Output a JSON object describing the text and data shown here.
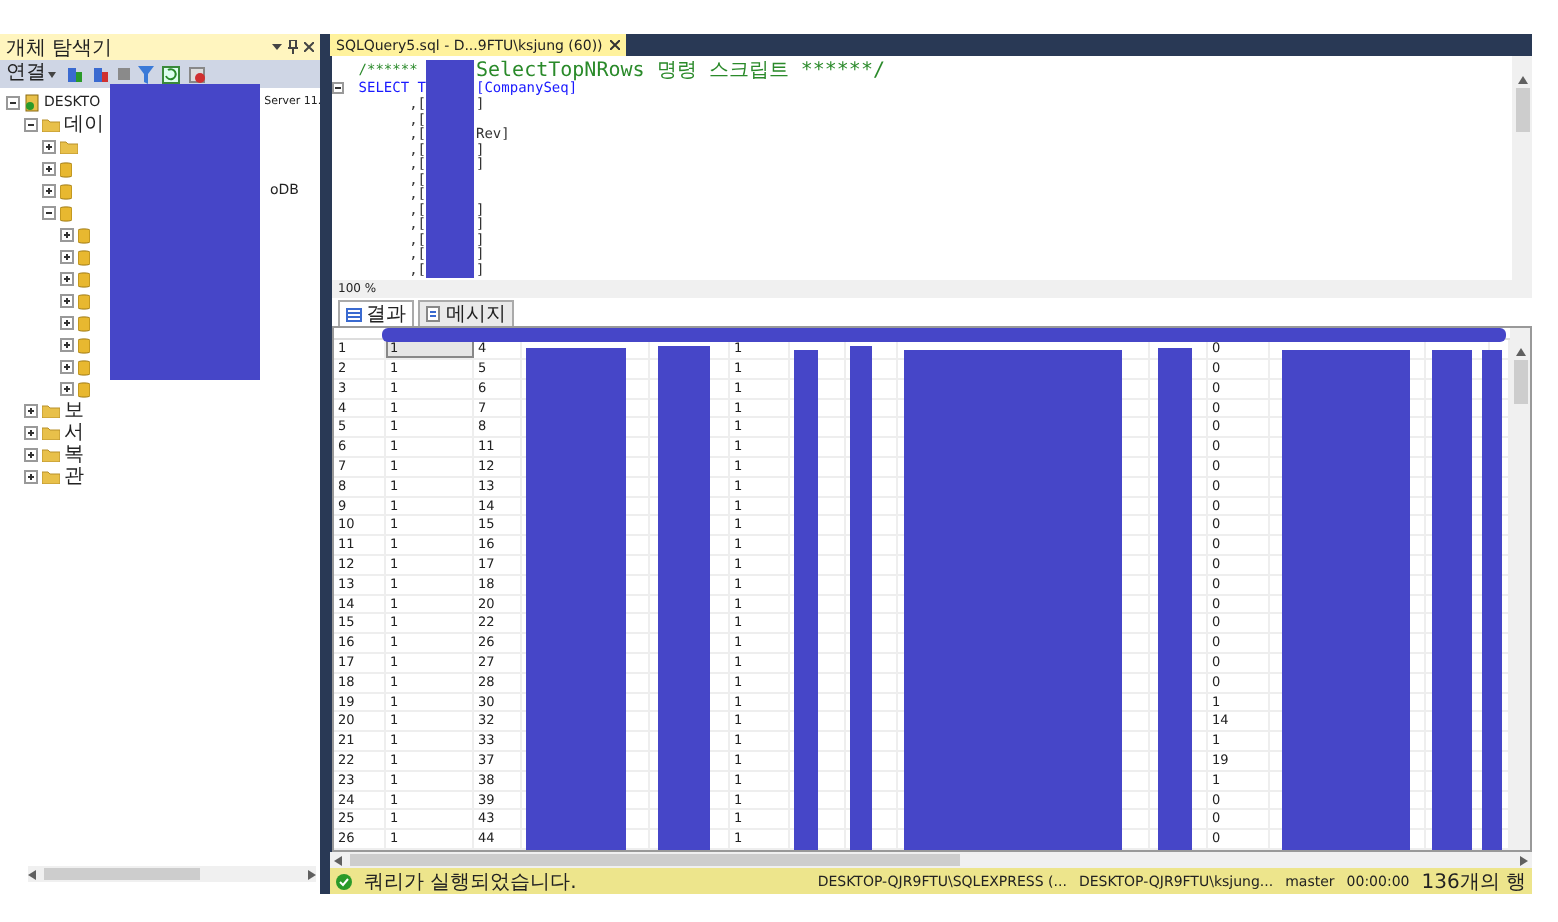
{
  "object_explorer": {
    "title": "개체 탐색기",
    "connect": "연결",
    "tree": [
      {
        "kind": "server",
        "label": "DESKTO",
        "label_after": "Server 11.",
        "expanded": true,
        "children": [
          {
            "kind": "folder",
            "label": "데이",
            "expanded": true,
            "children": [
              {
                "kind": "folder",
                "expanded": false
              },
              {
                "kind": "database",
                "expanded": false
              },
              {
                "kind": "database",
                "label_after": "oDB",
                "expanded": false
              },
              {
                "kind": "database",
                "expanded": true,
                "children": [
                  {
                    "kind": "database",
                    "expanded": false
                  },
                  {
                    "kind": "database",
                    "expanded": false
                  },
                  {
                    "kind": "database",
                    "expanded": false
                  },
                  {
                    "kind": "database",
                    "expanded": false
                  },
                  {
                    "kind": "database",
                    "expanded": false
                  },
                  {
                    "kind": "database",
                    "expanded": false
                  },
                  {
                    "kind": "database",
                    "expanded": false
                  },
                  {
                    "kind": "database",
                    "expanded": false
                  }
                ]
              }
            ]
          },
          {
            "kind": "folder",
            "label": "보",
            "expanded": false
          },
          {
            "kind": "folder",
            "label": "서",
            "expanded": false
          },
          {
            "kind": "folder",
            "label": "복",
            "expanded": false
          },
          {
            "kind": "folder",
            "label": "관",
            "expanded": false
          }
        ]
      }
    ]
  },
  "editor": {
    "tab": "SQLQuery5.sql - D...9FTU\\ksjung (60))",
    "zoom": "100 %",
    "lines": [
      {
        "kind": "comment",
        "before": "/****** ",
        "after": "SelectTopNRows 명령 스크립트 ******/"
      },
      {
        "kind": "keyword",
        "before": "SELECT T",
        "after": "[CompanySeq]"
      },
      {
        "kind": "plain",
        "before": ",[",
        "after": "]"
      },
      {
        "kind": "plain",
        "before": ",["
      },
      {
        "kind": "plain",
        "before": ",[",
        "after": "Rev]"
      },
      {
        "kind": "plain",
        "before": ",[",
        "after": "]"
      },
      {
        "kind": "plain",
        "before": ",[",
        "after": "]"
      },
      {
        "kind": "plain",
        "before": ",["
      },
      {
        "kind": "plain",
        "before": ",["
      },
      {
        "kind": "plain",
        "before": ",[",
        "after": "]"
      },
      {
        "kind": "plain",
        "before": ",[",
        "after": "]"
      },
      {
        "kind": "plain",
        "before": ",[",
        "after": "]"
      },
      {
        "kind": "plain",
        "before": ",[",
        "after": "]"
      },
      {
        "kind": "plain",
        "before": ",[",
        "after": "]"
      }
    ]
  },
  "results": {
    "tabs": [
      {
        "label": "결과",
        "kind": "grid",
        "selected": true
      },
      {
        "label": "메시지",
        "kind": "messages",
        "selected": false
      }
    ],
    "rows": [
      {
        "number": "1",
        "column_1": "1",
        "column_2": "4",
        "column_5": "1",
        "column_10": "0",
        "selected": true
      },
      {
        "number": "2",
        "column_1": "1",
        "column_2": "5",
        "column_5": "1",
        "column_10": "0",
        "selected": false
      },
      {
        "number": "3",
        "column_1": "1",
        "column_2": "6",
        "column_5": "1",
        "column_10": "0",
        "selected": false
      },
      {
        "number": "4",
        "column_1": "1",
        "column_2": "7",
        "column_5": "1",
        "column_10": "0",
        "selected": false
      },
      {
        "number": "5",
        "column_1": "1",
        "column_2": "8",
        "column_5": "1",
        "column_10": "0",
        "selected": false
      },
      {
        "number": "6",
        "column_1": "1",
        "column_2": "11",
        "column_5": "1",
        "column_10": "0",
        "selected": false
      },
      {
        "number": "7",
        "column_1": "1",
        "column_2": "12",
        "column_5": "1",
        "column_10": "0",
        "selected": false
      },
      {
        "number": "8",
        "column_1": "1",
        "column_2": "13",
        "column_5": "1",
        "column_10": "0",
        "selected": false
      },
      {
        "number": "9",
        "column_1": "1",
        "column_2": "14",
        "column_5": "1",
        "column_10": "0",
        "selected": false
      },
      {
        "number": "10",
        "column_1": "1",
        "column_2": "15",
        "column_5": "1",
        "column_10": "0",
        "selected": false
      },
      {
        "number": "11",
        "column_1": "1",
        "column_2": "16",
        "column_5": "1",
        "column_10": "0",
        "selected": false
      },
      {
        "number": "12",
        "column_1": "1",
        "column_2": "17",
        "column_5": "1",
        "column_10": "0",
        "selected": false
      },
      {
        "number": "13",
        "column_1": "1",
        "column_2": "18",
        "column_5": "1",
        "column_10": "0",
        "selected": false
      },
      {
        "number": "14",
        "column_1": "1",
        "column_2": "20",
        "column_5": "1",
        "column_10": "0",
        "selected": false
      },
      {
        "number": "15",
        "column_1": "1",
        "column_2": "22",
        "column_5": "1",
        "column_10": "0",
        "selected": false
      },
      {
        "number": "16",
        "column_1": "1",
        "column_2": "26",
        "column_5": "1",
        "column_10": "0",
        "selected": false
      },
      {
        "number": "17",
        "column_1": "1",
        "column_2": "27",
        "column_5": "1",
        "column_10": "0",
        "selected": false
      },
      {
        "number": "18",
        "column_1": "1",
        "column_2": "28",
        "column_5": "1",
        "column_10": "0",
        "selected": false
      },
      {
        "number": "19",
        "column_1": "1",
        "column_2": "30",
        "column_5": "1",
        "column_10": "1",
        "selected": false
      },
      {
        "number": "20",
        "column_1": "1",
        "column_2": "32",
        "column_5": "1",
        "column_10": "14",
        "selected": false
      },
      {
        "number": "21",
        "column_1": "1",
        "column_2": "33",
        "column_5": "1",
        "column_10": "1",
        "selected": false
      },
      {
        "number": "22",
        "column_1": "1",
        "column_2": "37",
        "column_5": "1",
        "column_10": "19",
        "selected": false
      },
      {
        "number": "23",
        "column_1": "1",
        "column_2": "38",
        "column_5": "1",
        "column_10": "1",
        "selected": false
      },
      {
        "number": "24",
        "column_1": "1",
        "column_2": "39",
        "column_5": "1",
        "column_10": "0",
        "selected": false
      },
      {
        "number": "25",
        "column_1": "1",
        "column_2": "43",
        "column_5": "1",
        "column_10": "0",
        "selected": false
      },
      {
        "number": "26",
        "column_1": "1",
        "column_2": "44",
        "column_5": "1",
        "column_10": "0",
        "selected": false
      }
    ]
  },
  "status_bar": {
    "message": "쿼리가 실행되었습니다.",
    "server": "DESKTOP-QJR9FTU\\SQLEXPRESS (...",
    "user": "DESKTOP-QJR9FTU\\ksjung...",
    "database": "master",
    "elapsed": "00:00:00",
    "row_count": "136개의 행"
  }
}
